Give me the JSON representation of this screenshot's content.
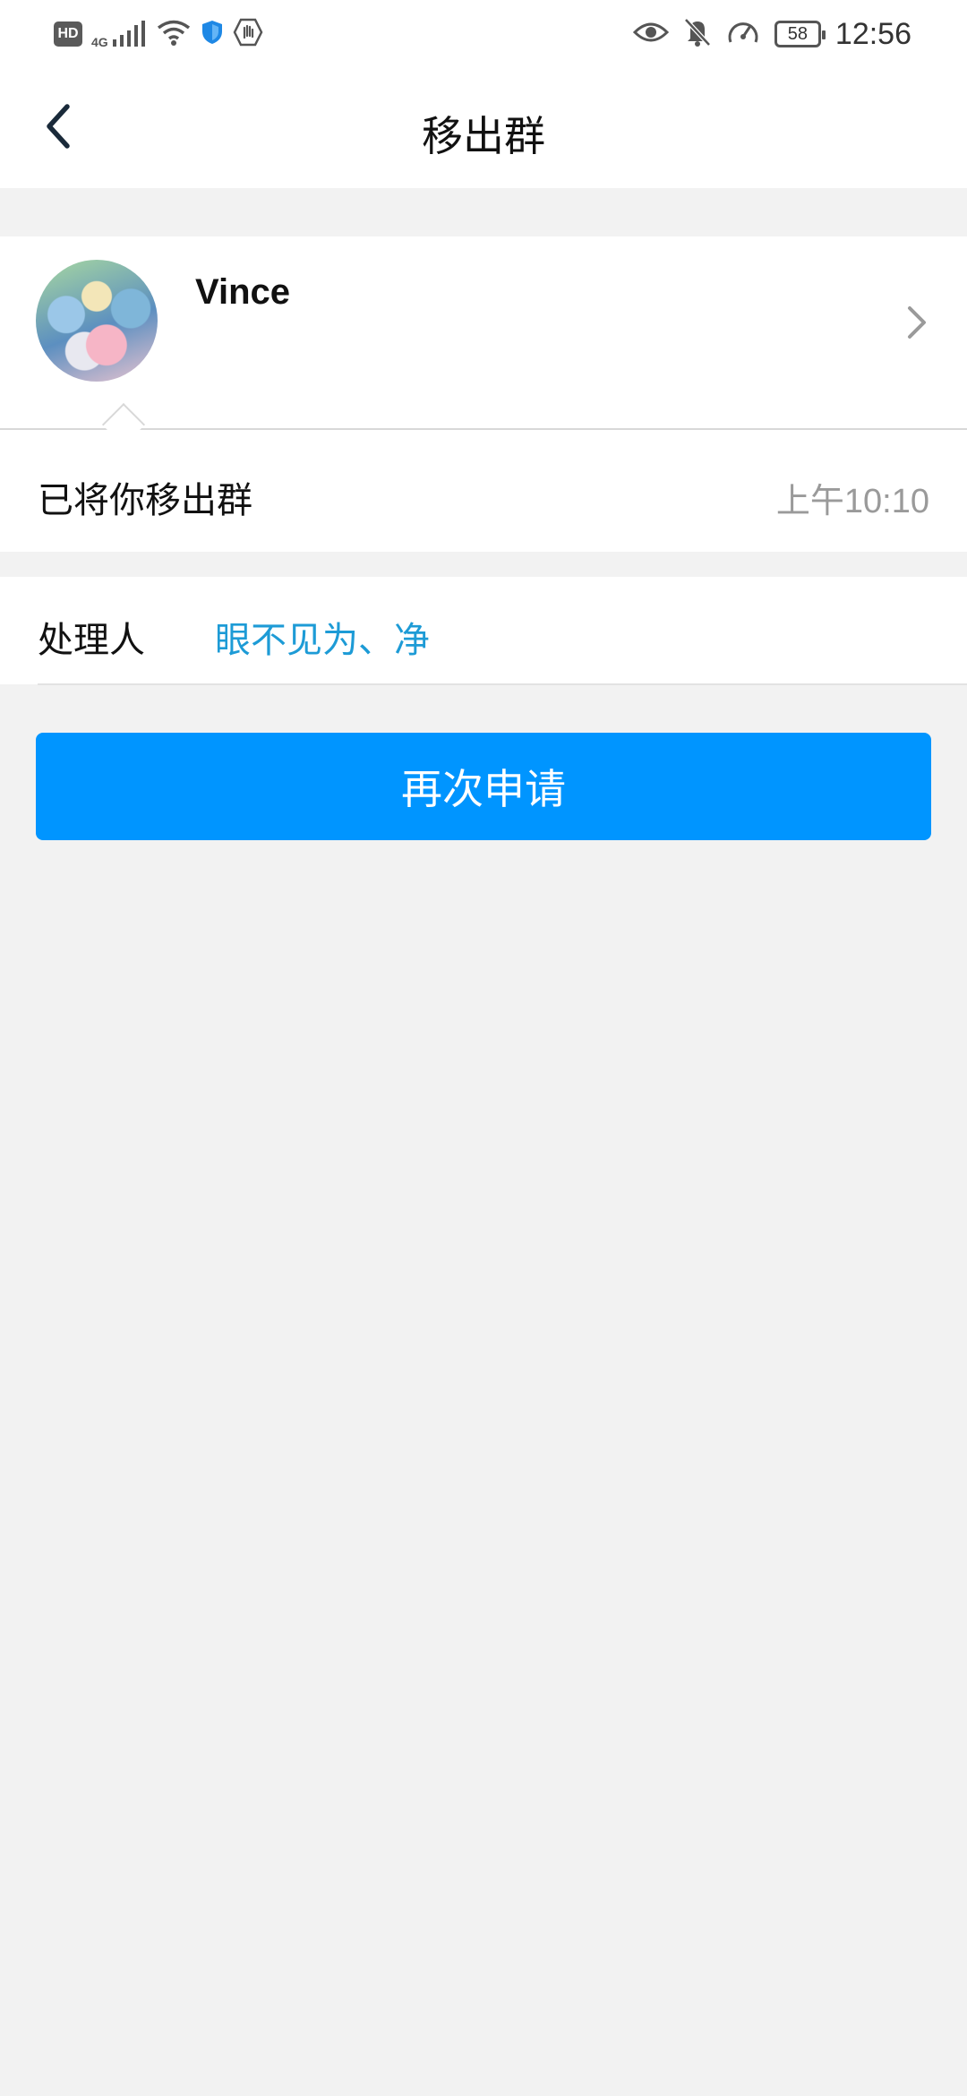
{
  "status_bar": {
    "hd_label": "HD",
    "network_label": "4G",
    "battery_level": "58",
    "time": "12:56",
    "icons": [
      "hd-icon",
      "signal-icon",
      "wifi-icon",
      "shield-icon",
      "hand-icon",
      "eye-icon",
      "bell-off-icon",
      "speed-icon",
      "battery-icon"
    ]
  },
  "nav": {
    "title": "移出群",
    "back_icon": "chevron-left-icon"
  },
  "profile": {
    "name": "Vince",
    "chevron_icon": "chevron-right-icon"
  },
  "message": {
    "text": "已将你移出群",
    "time": "上午10:10"
  },
  "handler": {
    "label": "处理人",
    "value": "眼不见为、净"
  },
  "actions": {
    "reapply_label": "再次申请"
  },
  "colors": {
    "accent": "#0095ff",
    "link": "#1d9bd6",
    "background": "#f2f2f2"
  }
}
